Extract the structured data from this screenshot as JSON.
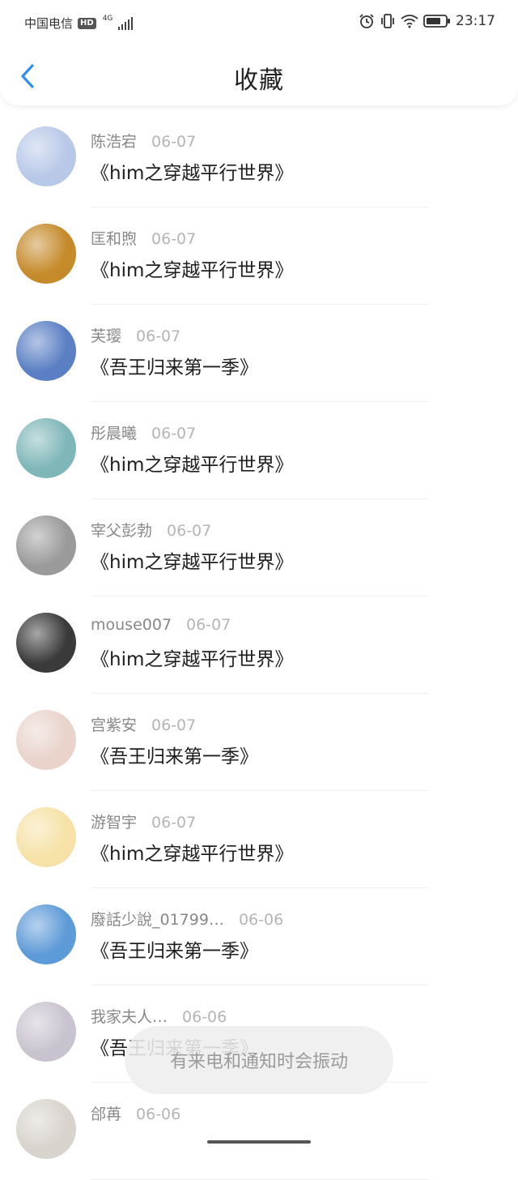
{
  "status_bar": {
    "carrier": "中国电信",
    "hd_badge": "HD",
    "network": "4G",
    "time": "23:17"
  },
  "header": {
    "title": "收藏"
  },
  "favorites": [
    {
      "name": "陈浩宕",
      "date": "06-07",
      "title": "《him之穿越平行世界》",
      "avatar_color": "#b8c8e8"
    },
    {
      "name": "匡和煦",
      "date": "06-07",
      "title": "《him之穿越平行世界》",
      "avatar_color": "#c58a2a"
    },
    {
      "name": "芙璎",
      "date": "06-07",
      "title": "《吾王归来第一季》",
      "avatar_color": "#5a7fc4"
    },
    {
      "name": "彤晨曦",
      "date": "06-07",
      "title": "《him之穿越平行世界》",
      "avatar_color": "#7fb6b8"
    },
    {
      "name": "宰父彭勃",
      "date": "06-07",
      "title": "《him之穿越平行世界》",
      "avatar_color": "#9a9a9a"
    },
    {
      "name": "mouse007",
      "date": "06-07",
      "title": "《him之穿越平行世界》",
      "avatar_color": "#3a3a3a"
    },
    {
      "name": "宫紫安",
      "date": "06-07",
      "title": "《吾王归来第一季》",
      "avatar_color": "#e9d3cb"
    },
    {
      "name": "游智宇",
      "date": "06-07",
      "title": "《him之穿越平行世界》",
      "avatar_color": "#f6e2a6"
    },
    {
      "name": "廢話少說_01799…",
      "date": "06-06",
      "title": "《吾王归来第一季》",
      "avatar_color": "#5d9ad8"
    },
    {
      "name": "我家夫人…",
      "date": "06-06",
      "title": "《吾王归来第一季》",
      "avatar_color": "#c9c3cf"
    },
    {
      "name": "郃苒",
      "date": "06-06",
      "title": "",
      "avatar_color": "#d8d3cc"
    }
  ],
  "toast": {
    "text": "有来电和通知时会振动"
  }
}
